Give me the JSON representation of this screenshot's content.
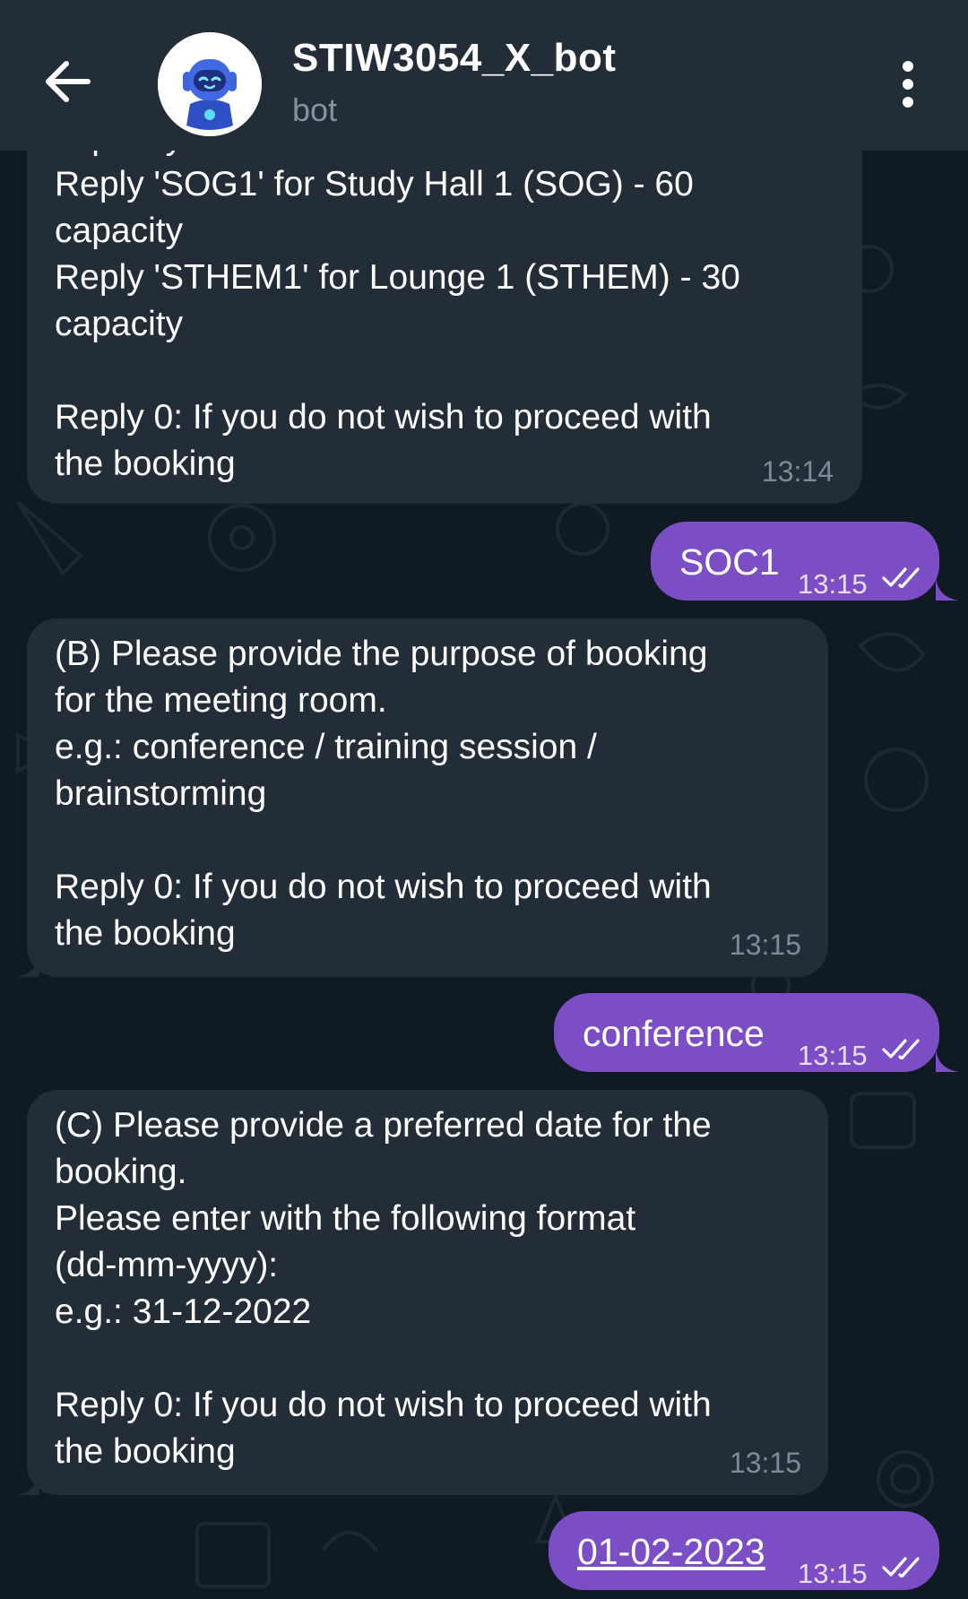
{
  "header": {
    "title": "STIW3054_X_bot",
    "subtitle": "bot"
  },
  "messages": [
    {
      "direction": "incoming",
      "lines": [
        "capacity",
        "Reply 'SOG1' for Study Hall 1 (SOG) - 60",
        "capacity",
        "Reply 'STHEM1' for Lounge 1 (STHEM) - 30",
        "capacity",
        "",
        "Reply 0: If you do not wish to proceed with",
        "the booking"
      ],
      "time": "13:14"
    },
    {
      "direction": "outgoing",
      "text": "SOC1",
      "time": "13:15"
    },
    {
      "direction": "incoming",
      "lines": [
        "(B) Please provide the purpose of booking",
        "for the meeting room.",
        "e.g.: conference / training session /",
        "brainstorming",
        "",
        "Reply 0: If you do not wish to proceed with",
        "the booking"
      ],
      "time": "13:15"
    },
    {
      "direction": "outgoing",
      "text": "conference",
      "time": "13:15"
    },
    {
      "direction": "incoming",
      "lines": [
        "(C) Please provide a preferred date for the",
        "booking.",
        "Please enter with the following format",
        "(dd-mm-yyyy):",
        "e.g.: 31-12-2022",
        "",
        "Reply 0: If you do not wish to proceed with",
        "the booking"
      ],
      "time": "13:15"
    },
    {
      "direction": "outgoing",
      "text": "01-02-2023",
      "time": "13:15"
    }
  ],
  "colors": {
    "header_bg": "#222d38",
    "incoming_bubble": "#222d38",
    "outgoing_bubble": "#7b4ec6",
    "chat_background": "#101a22"
  },
  "icons": {
    "back": "arrow-left-icon",
    "menu": "more-vertical-icon",
    "avatar": "robot-avatar",
    "read_status": "double-check-icon"
  }
}
